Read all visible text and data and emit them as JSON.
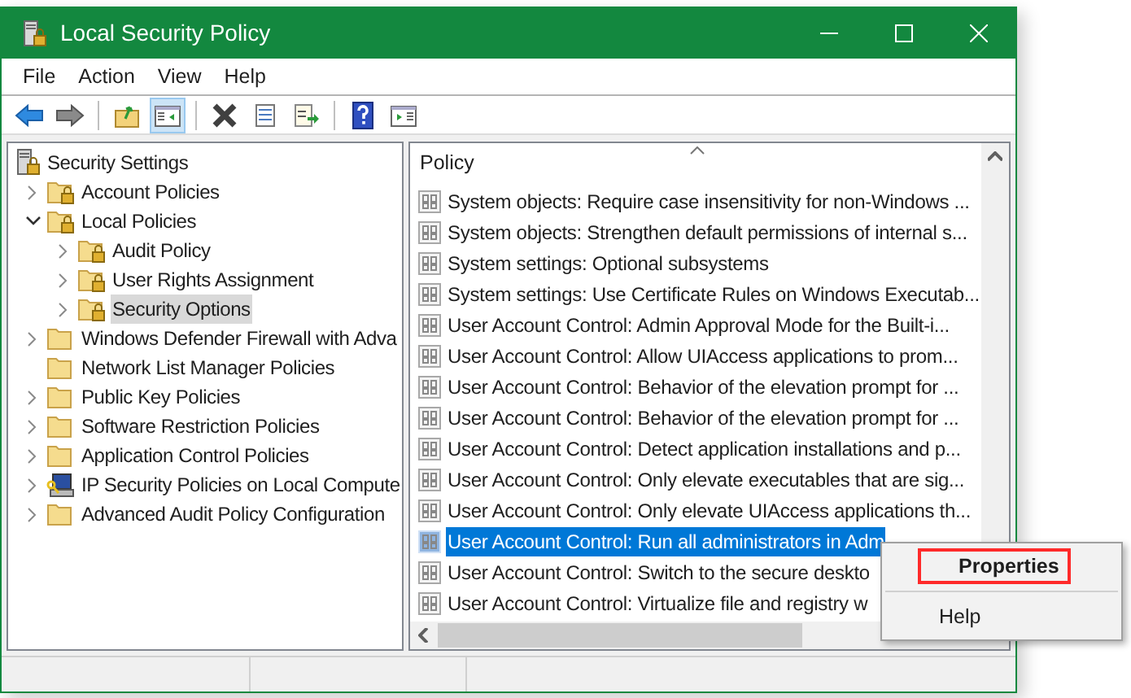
{
  "window": {
    "title": "Local Security Policy"
  },
  "menu": [
    "File",
    "Action",
    "View",
    "Help"
  ],
  "toolbar": [
    {
      "kind": "back",
      "selected": false
    },
    {
      "kind": "forward",
      "selected": false
    },
    {
      "kind": "sep"
    },
    {
      "kind": "up",
      "selected": false
    },
    {
      "kind": "tree",
      "selected": true
    },
    {
      "kind": "sep"
    },
    {
      "kind": "delete",
      "selected": false
    },
    {
      "kind": "properties",
      "selected": false
    },
    {
      "kind": "export",
      "selected": false
    },
    {
      "kind": "sep"
    },
    {
      "kind": "help",
      "selected": false
    },
    {
      "kind": "pane",
      "selected": false
    }
  ],
  "tree": {
    "label": "Security Settings",
    "kind": "server",
    "children": [
      {
        "label": "Account Policies",
        "kind": "locked_folder",
        "expanded": false,
        "selected": false
      },
      {
        "label": "Local Policies",
        "kind": "locked_folder",
        "expanded": true,
        "selected": false,
        "children": [
          {
            "label": "Audit Policy",
            "kind": "locked_folder",
            "expanded": false,
            "selected": false
          },
          {
            "label": "User Rights Assignment",
            "kind": "locked_folder",
            "expanded": false,
            "selected": false
          },
          {
            "label": "Security Options",
            "kind": "locked_folder",
            "expanded": false,
            "selected": true
          }
        ]
      },
      {
        "label": "Windows Defender Firewall with Adva",
        "kind": "folder",
        "expanded": false,
        "selected": false
      },
      {
        "label": "Network List Manager Policies",
        "kind": "folder",
        "selected": false
      },
      {
        "label": "Public Key Policies",
        "kind": "folder",
        "expanded": false,
        "selected": false
      },
      {
        "label": "Software Restriction Policies",
        "kind": "folder",
        "expanded": false,
        "selected": false
      },
      {
        "label": "Application Control Policies",
        "kind": "folder",
        "expanded": false,
        "selected": false
      },
      {
        "label": "IP Security Policies on Local Compute",
        "kind": "computer",
        "expanded": false,
        "selected": false
      },
      {
        "label": "Advanced Audit Policy Configuration",
        "kind": "folder",
        "expanded": false,
        "selected": false
      }
    ]
  },
  "list": {
    "column": "Policy",
    "rows": [
      {
        "text": "System objects: Require case insensitivity for non-Windows ...",
        "selected": false
      },
      {
        "text": "System objects: Strengthen default permissions of internal s...",
        "selected": false
      },
      {
        "text": "System settings: Optional subsystems",
        "selected": false
      },
      {
        "text": "System settings: Use Certificate Rules on Windows Executab...",
        "selected": false
      },
      {
        "text": "User Account Control: Admin Approval Mode for the Built-i...",
        "selected": false
      },
      {
        "text": "User Account Control: Allow UIAccess applications to prom...",
        "selected": false
      },
      {
        "text": "User Account Control: Behavior of the elevation prompt for ...",
        "selected": false
      },
      {
        "text": "User Account Control: Behavior of the elevation prompt for ...",
        "selected": false
      },
      {
        "text": "User Account Control: Detect application installations and p...",
        "selected": false
      },
      {
        "text": "User Account Control: Only elevate executables that are sig...",
        "selected": false
      },
      {
        "text": "User Account Control: Only elevate UIAccess applications th...",
        "selected": false
      },
      {
        "text": "User Account Control: Run all administrators in Adm",
        "selected": true
      },
      {
        "text": "User Account Control: Switch to the secure deskto",
        "selected": false
      },
      {
        "text": "User Account Control: Virtualize file and registry w",
        "selected": false
      }
    ]
  },
  "context_menu": [
    {
      "label": "Properties",
      "bold": true,
      "highlighted": true
    },
    {
      "kind": "sep"
    },
    {
      "label": "Help",
      "bold": false,
      "highlighted": false
    }
  ]
}
